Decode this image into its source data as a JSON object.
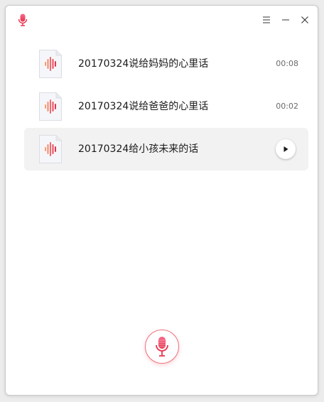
{
  "app": {
    "icon": "microphone-icon"
  },
  "titlebar": {
    "menu_icon": "menu-icon",
    "minimize_icon": "minimize-icon",
    "close_icon": "close-icon"
  },
  "recordings": [
    {
      "title": "20170324说给妈妈的心里话",
      "duration": "00:08",
      "selected": false
    },
    {
      "title": "20170324说给爸爸的心里话",
      "duration": "00:02",
      "selected": false
    },
    {
      "title": "20170324给小孩未来的话",
      "duration": "",
      "selected": true
    }
  ],
  "colors": {
    "accent": "#f04a64",
    "wave_light": "#f7a06a",
    "wave_dark": "#e8344e"
  }
}
